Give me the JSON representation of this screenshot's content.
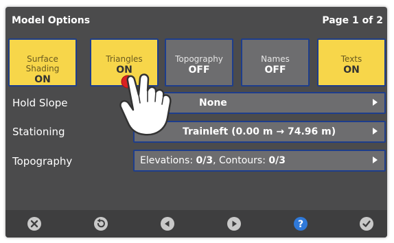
{
  "header": {
    "title": "Model Options",
    "page_indicator": "Page 1 of 2"
  },
  "toggles": [
    {
      "label": "Surface Shading",
      "state": "ON"
    },
    {
      "label": "Triangles",
      "state": "ON"
    },
    {
      "label": "Topography",
      "state": "OFF"
    },
    {
      "label": "Names",
      "state": "OFF"
    },
    {
      "label": "Texts",
      "state": "ON"
    }
  ],
  "rows": {
    "hold_slope": {
      "label": "Hold Slope",
      "value": "None"
    },
    "stationing": {
      "label": "Stationing",
      "value": "Trainleft (0.00 m → 74.96 m)"
    },
    "topography": {
      "label": "Topography",
      "elev_label": "Elevations: ",
      "elev_value": "0/3",
      "cont_label": ", Contours: ",
      "cont_value": "0/3"
    }
  },
  "toolbar": {
    "icons": [
      "close-icon",
      "reset-icon",
      "previous-icon",
      "next-icon",
      "help-icon",
      "confirm-icon"
    ]
  },
  "colors": {
    "on": "#f7d64a",
    "off": "#6d6d6f",
    "border": "#1d3d8c",
    "panel": "#4b4b4c",
    "help": "#2f79d9"
  }
}
